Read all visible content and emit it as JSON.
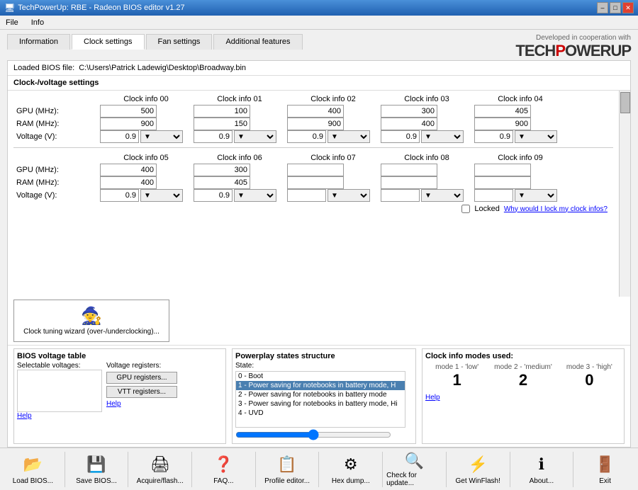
{
  "titleBar": {
    "title": "TechPowerUp: RBE - Radeon BIOS editor v1.27",
    "controls": [
      "–",
      "□",
      "✕"
    ]
  },
  "menu": {
    "items": [
      "File",
      "Info"
    ]
  },
  "header": {
    "developed_by": "Developed in cooperation with",
    "brand": "TECHP",
    "brand_highlight": "O",
    "brand_rest": "WERUP"
  },
  "tabs": [
    {
      "label": "Information",
      "active": false
    },
    {
      "label": "Clock settings",
      "active": true
    },
    {
      "label": "Fan settings",
      "active": false
    },
    {
      "label": "Additional features",
      "active": false
    }
  ],
  "bios_file": {
    "label": "Loaded BIOS file:",
    "path": "C:\\Users\\Patrick Ladewig\\Desktop\\Broadway.bin"
  },
  "clock_voltage": {
    "section_title": "Clock-/voltage settings",
    "row1_headers": [
      "",
      "Clock info 00",
      "Clock info 01",
      "Clock info 02",
      "Clock info 03",
      "Clock info 04"
    ],
    "row2_headers": [
      "",
      "Clock info 05",
      "Clock info 06",
      "Clock info 07",
      "Clock info 08",
      "Clock info 09"
    ],
    "labels": [
      "GPU (MHz):",
      "RAM (MHz):",
      "Voltage (V):"
    ],
    "row1": {
      "gpu": [
        "500",
        "100",
        "400",
        "300",
        "405"
      ],
      "ram": [
        "900",
        "150",
        "900",
        "400",
        "900"
      ],
      "voltage": [
        "0.9",
        "0.9",
        "0.9",
        "0.9",
        "0.9"
      ]
    },
    "row2": {
      "gpu": [
        "400",
        "300",
        "",
        "",
        ""
      ],
      "ram": [
        "400",
        "405",
        "",
        "",
        ""
      ],
      "voltage": [
        "0.9",
        "0.9",
        "",
        "",
        ""
      ]
    }
  },
  "locked": {
    "checkbox_label": "Locked",
    "link_text": "Why would I lock my clock infos?"
  },
  "wizard": {
    "label": "Clock tuning wizard (over-/underclocking)..."
  },
  "bios_voltage_table": {
    "title": "BIOS voltage table",
    "sel_voltages_label": "Selectable voltages:",
    "vregs_label": "Voltage registers:",
    "gpu_regs_btn": "GPU registers...",
    "vtt_regs_btn": "VTT registers...",
    "help": "Help"
  },
  "powerplay": {
    "title": "Powerplay states structure",
    "state_label": "State:",
    "items": [
      {
        "text": "0 - Boot",
        "selected": false
      },
      {
        "text": "1 - Power saving for notebooks in battery mode, H",
        "selected": true
      },
      {
        "text": "2 - Power saving for notebooks in battery mode",
        "selected": false
      },
      {
        "text": "3 - Power saving for notebooks in battery mode, Hi",
        "selected": false
      },
      {
        "text": "4 - UVD",
        "selected": false
      }
    ]
  },
  "clock_modes": {
    "title": "Clock info modes used:",
    "modes": [
      {
        "label": "mode 1 - 'low'",
        "value": "1"
      },
      {
        "label": "mode 2 - 'medium'",
        "value": "2"
      },
      {
        "label": "mode 3 - 'high'",
        "value": "0"
      }
    ],
    "help": "Help"
  },
  "toolbar": {
    "buttons": [
      {
        "label": "Load BIOS...",
        "icon": "📂",
        "name": "load-bios-button"
      },
      {
        "label": "Save BIOS...",
        "icon": "💾",
        "name": "save-bios-button"
      },
      {
        "label": "Acquire/flash...",
        "icon": "🖨",
        "name": "acquire-flash-button"
      },
      {
        "label": "FAQ...",
        "icon": "❓",
        "name": "faq-button"
      },
      {
        "label": "Profile editor...",
        "icon": "📋",
        "name": "profile-editor-button"
      },
      {
        "label": "Hex dump...",
        "icon": "⚙",
        "name": "hex-dump-button"
      },
      {
        "label": "Check for update...",
        "icon": "🔍",
        "name": "check-update-button"
      },
      {
        "label": "Get WinFlash!",
        "icon": "⚡",
        "name": "get-winflash-button"
      },
      {
        "label": "About...",
        "icon": "ℹ",
        "name": "about-button"
      },
      {
        "label": "Exit",
        "icon": "🚪",
        "name": "exit-button"
      }
    ]
  }
}
